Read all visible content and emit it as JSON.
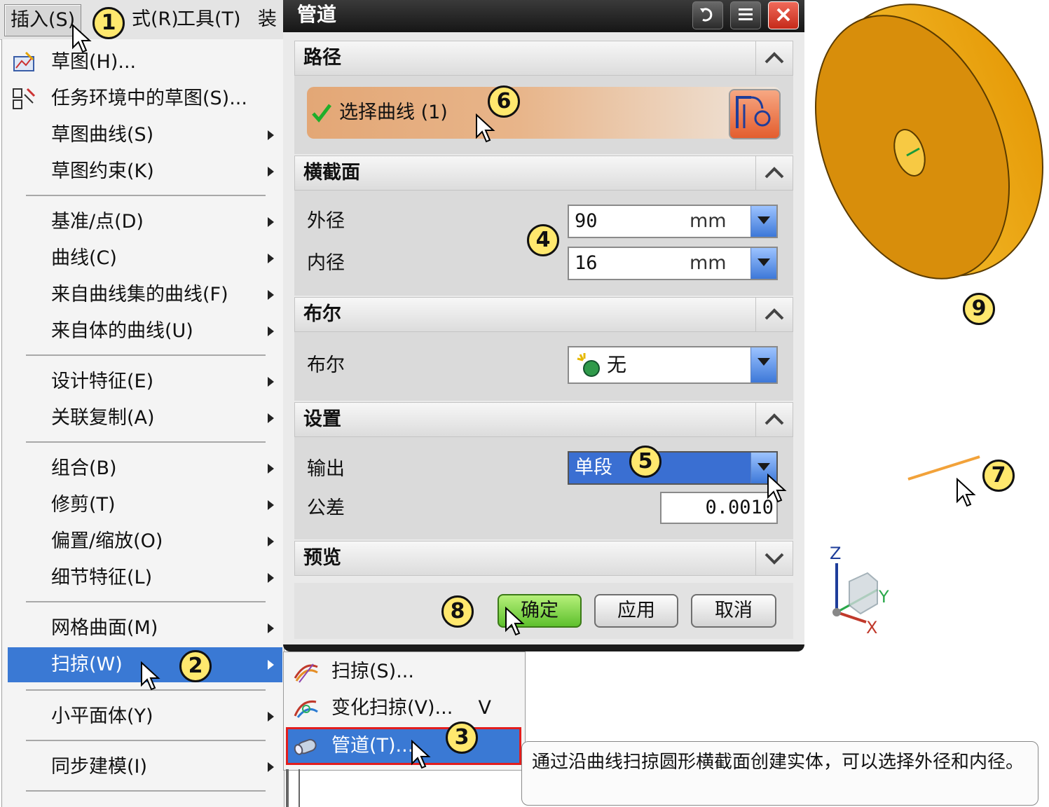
{
  "menubar": {
    "insert": "插入(S)",
    "analysis_partial": "式(R)",
    "tools": "工具(T)",
    "assembly_partial": "装"
  },
  "insert_menu": {
    "items": [
      {
        "label": "草图(H)...",
        "icon": "sketch-icon",
        "submenu": false
      },
      {
        "label": "任务环境中的草图(S)...",
        "icon": "sketch-task-icon",
        "submenu": false
      },
      {
        "label": "草图曲线(S)",
        "submenu": true
      },
      {
        "label": "草图约束(K)",
        "submenu": true
      },
      {
        "label": "基准/点(D)",
        "submenu": true
      },
      {
        "label": "曲线(C)",
        "submenu": true
      },
      {
        "label": "来自曲线集的曲线(F)",
        "submenu": true
      },
      {
        "label": "来自体的曲线(U)",
        "submenu": true
      },
      {
        "label": "设计特征(E)",
        "submenu": true
      },
      {
        "label": "关联复制(A)",
        "submenu": true
      },
      {
        "label": "组合(B)",
        "submenu": true
      },
      {
        "label": "修剪(T)",
        "submenu": true
      },
      {
        "label": "偏置/缩放(O)",
        "submenu": true
      },
      {
        "label": "细节特征(L)",
        "submenu": true
      },
      {
        "label": "网格曲面(M)",
        "submenu": true
      },
      {
        "label": "扫掠(W)",
        "submenu": true,
        "highlighted": true
      },
      {
        "label": "小平面体(Y)",
        "submenu": true
      },
      {
        "label": "同步建模(I)",
        "submenu": true
      }
    ]
  },
  "sweep_submenu": {
    "items": [
      {
        "label": "扫掠(S)...",
        "shortcut": ""
      },
      {
        "label": "变化扫掠(V)...",
        "shortcut": "V"
      },
      {
        "label": "管道(T)...",
        "shortcut": "",
        "highlighted": true
      }
    ]
  },
  "tooltip": {
    "text": "通过沿曲线扫掠圆形横截面创建实体，可以选择外径和内径。"
  },
  "dialog": {
    "title": "管道",
    "sections": {
      "path": {
        "title": "路径",
        "select_curve": "选择曲线 (1)"
      },
      "cross_section": {
        "title": "横截面",
        "outer_label": "外径",
        "outer_value": "90",
        "outer_unit": "mm",
        "inner_label": "内径",
        "inner_value": "16",
        "inner_unit": "mm"
      },
      "boolean": {
        "title": "布尔",
        "label": "布尔",
        "value": "无"
      },
      "settings": {
        "title": "设置",
        "output_label": "输出",
        "output_value": "单段",
        "tolerance_label": "公差",
        "tolerance_value": "0.0010"
      },
      "preview": {
        "title": "预览"
      }
    },
    "buttons": {
      "ok": "确定",
      "apply": "应用",
      "cancel": "取消"
    }
  },
  "callouts": [
    "1",
    "2",
    "3",
    "4",
    "5",
    "6",
    "7",
    "8",
    "9"
  ],
  "triad": {
    "z": "Z",
    "y": "Y",
    "x": "X"
  },
  "colors": {
    "highlight": "#3a79d4",
    "callout_fill": "#ffe86e",
    "solid_body": "#e29e0c",
    "curve": "#f2a23a",
    "red_box": "#e21d1d"
  }
}
